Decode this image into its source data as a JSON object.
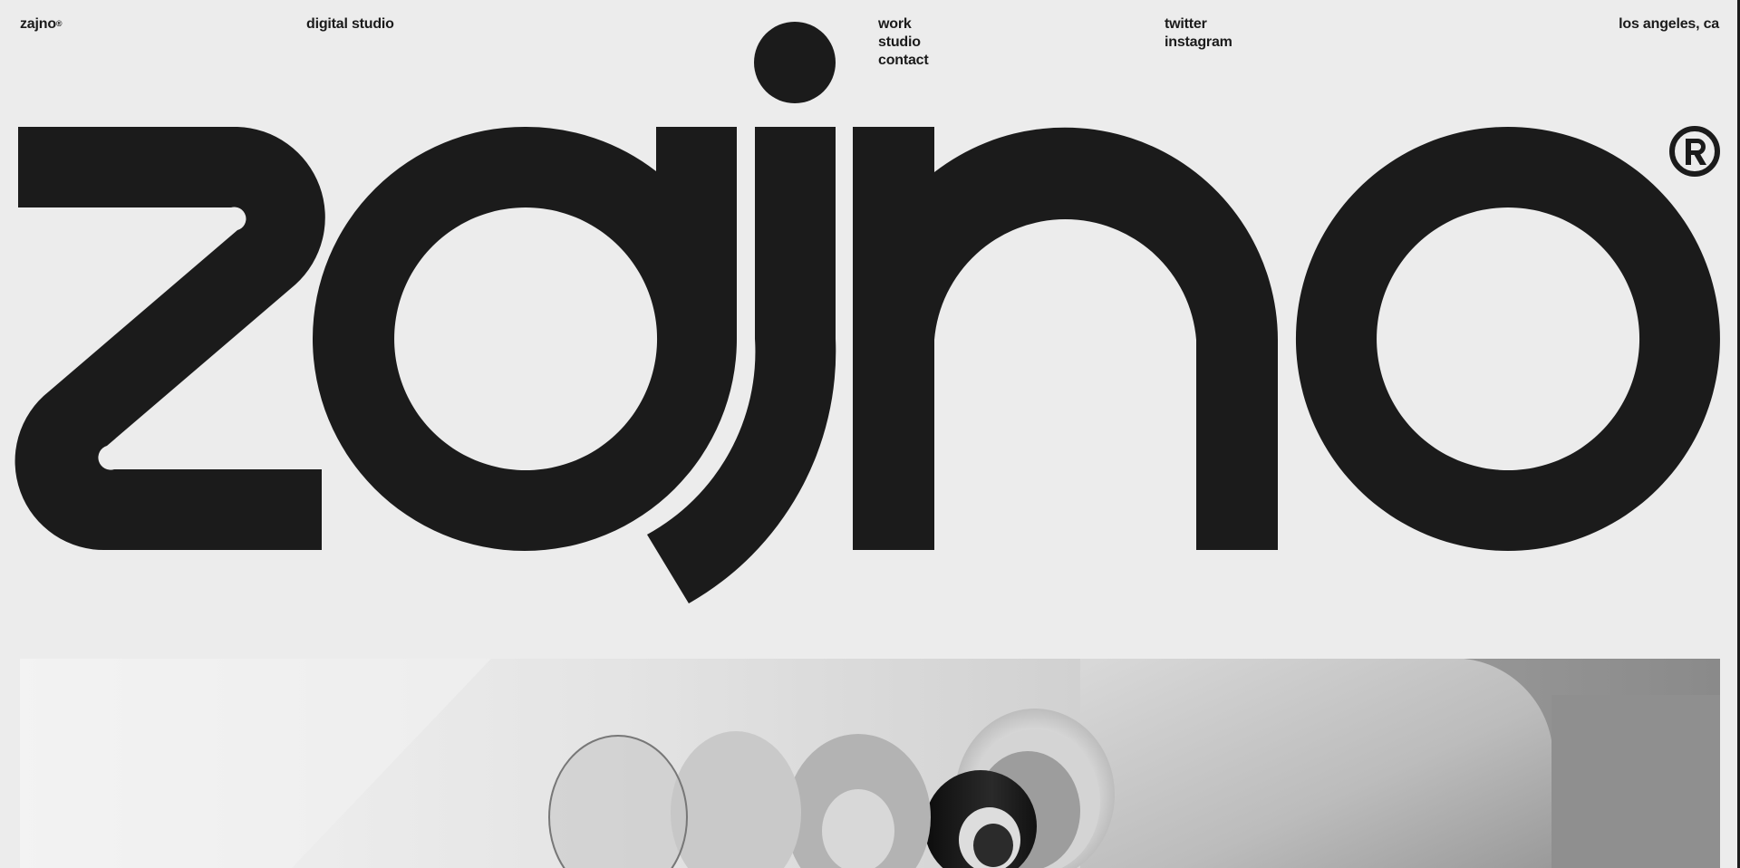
{
  "header": {
    "brand": "zajno",
    "brand_mark": "®",
    "tagline": "digital studio",
    "nav": [
      {
        "label": "work"
      },
      {
        "label": "studio"
      },
      {
        "label": "contact"
      }
    ],
    "social": [
      {
        "label": "twitter"
      },
      {
        "label": "instagram"
      }
    ],
    "location": "los angeles, ca"
  },
  "hero": {
    "wordmark": "zajno",
    "wordmark_mark": "®",
    "image_subject": "camera-lens-parts-render"
  },
  "colors": {
    "background": "#ececec",
    "ink": "#1b1b1b"
  }
}
